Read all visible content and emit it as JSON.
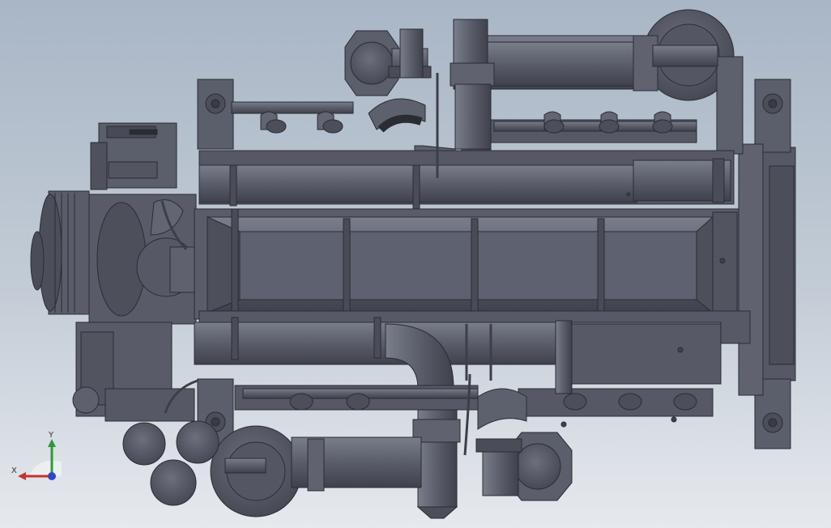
{
  "viewport": {
    "background_top": "#a9b6c6",
    "background_bottom": "#e6e9ee",
    "model_color": "#5b5e6b",
    "edge_color": "#2a2c33"
  },
  "triad": {
    "x_label": "X",
    "y_label": "Y",
    "x_color": "#c8312c",
    "y_color": "#2e9a37",
    "z_color": "#2f46c9"
  }
}
